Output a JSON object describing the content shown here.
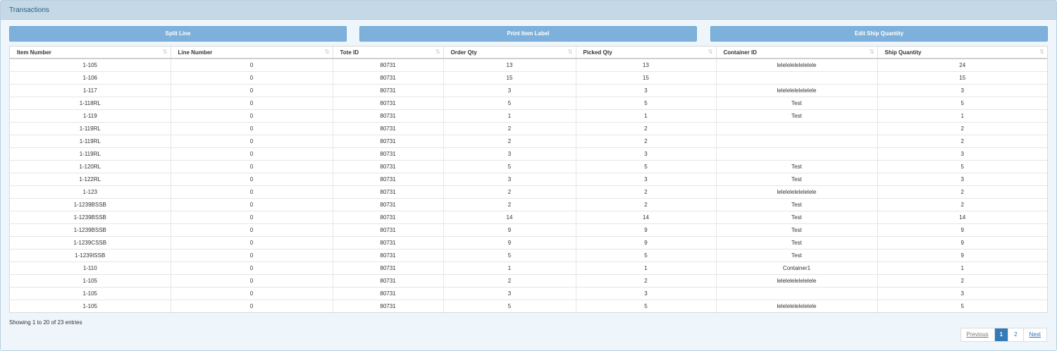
{
  "panel": {
    "title": "Transactions"
  },
  "toolbar": {
    "split_label": "Split Line",
    "print_label": "Print Item Label",
    "edit_label": "Edit Ship Quantity"
  },
  "table": {
    "columns": [
      "Item Number",
      "Line Number",
      "Tote ID",
      "Order Qty",
      "Picked Qty",
      "Container ID",
      "Ship Quantity"
    ],
    "rows": [
      [
        "1-105",
        "0",
        "80731",
        "13",
        "13",
        "lelelelelelelelele",
        "24"
      ],
      [
        "1-106",
        "0",
        "80731",
        "15",
        "15",
        "",
        "15"
      ],
      [
        "1-117",
        "0",
        "80731",
        "3",
        "3",
        "lelelelelelelelele",
        "3"
      ],
      [
        "1-118RL",
        "0",
        "80731",
        "5",
        "5",
        "Test",
        "5"
      ],
      [
        "1-119",
        "0",
        "80731",
        "1",
        "1",
        "Test",
        "1"
      ],
      [
        "1-119RL",
        "0",
        "80731",
        "2",
        "2",
        "",
        "2"
      ],
      [
        "1-119RL",
        "0",
        "80731",
        "2",
        "2",
        "",
        "2"
      ],
      [
        "1-119RL",
        "0",
        "80731",
        "3",
        "3",
        "",
        "3"
      ],
      [
        "1-120RL",
        "0",
        "80731",
        "5",
        "5",
        "Test",
        "5"
      ],
      [
        "1-122RL",
        "0",
        "80731",
        "3",
        "3",
        "Test",
        "3"
      ],
      [
        "1-123",
        "0",
        "80731",
        "2",
        "2",
        "lelelelelelelelele",
        "2"
      ],
      [
        "1-1239BSSB",
        "0",
        "80731",
        "2",
        "2",
        "Test",
        "2"
      ],
      [
        "1-1239BSSB",
        "0",
        "80731",
        "14",
        "14",
        "Test",
        "14"
      ],
      [
        "1-1239BSSB",
        "0",
        "80731",
        "9",
        "9",
        "Test",
        "9"
      ],
      [
        "1-1239CSSB",
        "0",
        "80731",
        "9",
        "9",
        "Test",
        "9"
      ],
      [
        "1-1239ISSB",
        "0",
        "80731",
        "5",
        "5",
        "Test",
        "9"
      ],
      [
        "1-110",
        "0",
        "80731",
        "1",
        "1",
        "Container1",
        "1"
      ],
      [
        "1-105",
        "0",
        "80731",
        "2",
        "2",
        "lelelelelelelelele",
        "2"
      ],
      [
        "1-105",
        "0",
        "80731",
        "3",
        "3",
        "",
        "3"
      ],
      [
        "1-105",
        "0",
        "80731",
        "5",
        "5",
        "lelelelelelelelele",
        "5"
      ]
    ]
  },
  "info_text": "Showing 1 to 20 of 23 entries",
  "pagination": {
    "previous": "Previous",
    "pages": [
      "1",
      "2"
    ],
    "active_page": "1",
    "next": "Next"
  },
  "colors": {
    "button_bg": "#7db1db",
    "header_bg": "#c5d8e6",
    "active_page_bg": "#337ab7"
  }
}
